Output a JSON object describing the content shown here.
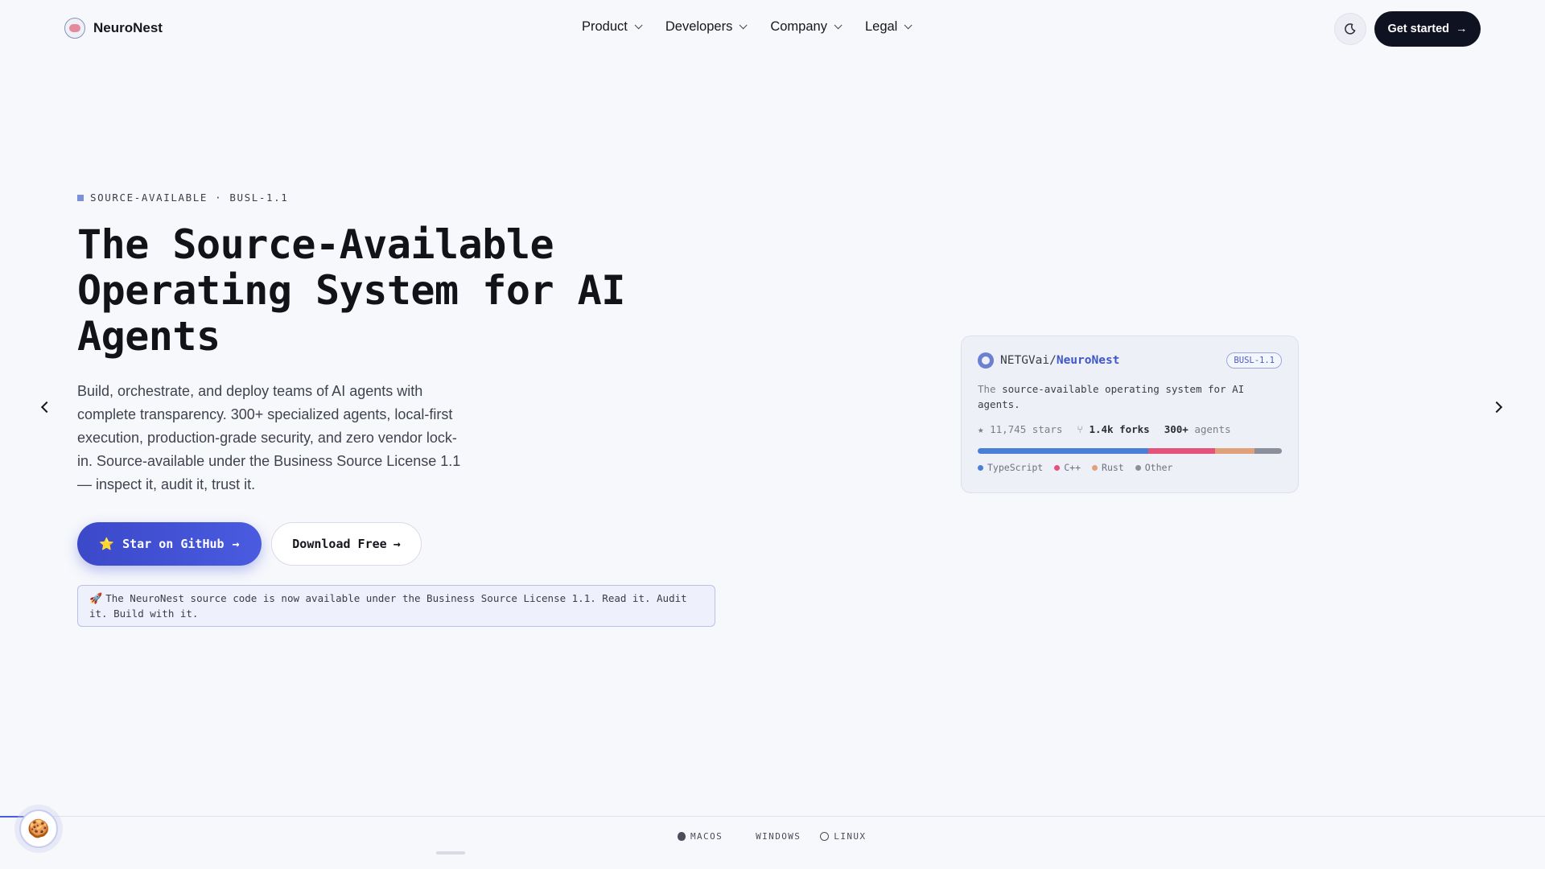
{
  "nav": {
    "brand": "NeuroNest",
    "menu": [
      "Product",
      "Developers",
      "Company",
      "Legal"
    ],
    "cta_label": "Get started"
  },
  "hero": {
    "eyebrow": "SOURCE-AVAILABLE · BUSL-1.1",
    "title": "The Source-Available Operating System for AI Agents",
    "description": "Build, orchestrate, and deploy teams of AI agents with complete transparency. 300+ specialized agents, local-first execution, production-grade security, and zero vendor lock-in. Source-available under the Business Source License 1.1 — inspect it, audit it, trust it.",
    "primary_button": "Star on GitHub",
    "secondary_button": "Download Free",
    "announcement": "The NeuroNest source code is now available under the Business Source License 1.1. Read it. Audit it. Build with it."
  },
  "repo_card": {
    "owner": "NETGVai/",
    "repo": "NeuroNest",
    "license": "BUSL-1.1",
    "description_prefix": "The ",
    "description_mid": "source-available",
    "description_suffix": " operating system for AI agents.",
    "stars": "11,745",
    "stars_label": "stars",
    "forks": "1.4k",
    "forks_label": "forks",
    "agents": "300+",
    "agents_label": "agents",
    "languages": [
      {
        "name": "TypeScript",
        "share": 0.56,
        "color": "#4a7fd6"
      },
      {
        "name": "C++",
        "share": 0.22,
        "color": "#e5527a"
      },
      {
        "name": "Rust",
        "share": 0.13,
        "color": "#e0a07a"
      },
      {
        "name": "Other",
        "share": 0.09,
        "color": "#8b8f9b"
      }
    ]
  },
  "platforms": [
    "MACOS",
    "WINDOWS",
    "LINUX"
  ],
  "colors": {
    "accent": "#4a5be0",
    "dark_cta": "#0f1220",
    "background": "#f7f8fc"
  }
}
